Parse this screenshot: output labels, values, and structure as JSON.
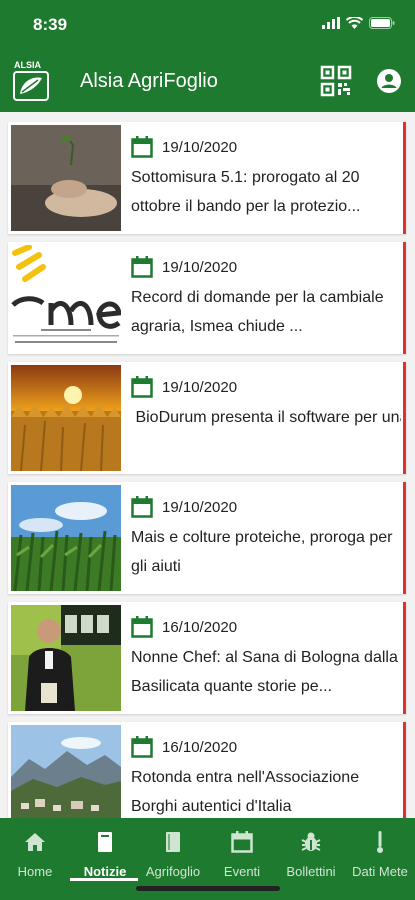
{
  "status_bar": {
    "time": "8:39"
  },
  "header": {
    "title": "Alsia AgriFoglio",
    "logo_text": "ALSIA"
  },
  "news": [
    {
      "date": "19/10/2020",
      "title": "Sottomisura 5.1: prorogato al 20 ottobre il bando per la protezio..."
    },
    {
      "date": "19/10/2020",
      "title": "Record di domande per la cambiale agraria, Ismea chiude ..."
    },
    {
      "date": "19/10/2020",
      "title": " BioDurum presenta il software per una gestione sostenibile del..."
    },
    {
      "date": "19/10/2020",
      "title": "Mais e colture proteiche, proroga per gli aiuti"
    },
    {
      "date": "16/10/2020",
      "title": "Nonne Chef: al Sana di Bologna dalla Basilicata quante storie pe..."
    },
    {
      "date": "16/10/2020",
      "title": "Rotonda entra nell'Associazione Borghi autentici d'Italia"
    }
  ],
  "nav": [
    {
      "label": "Home",
      "icon": "home-icon"
    },
    {
      "label": "Notizie",
      "icon": "news-icon",
      "active": true
    },
    {
      "label": "Agrifoglio",
      "icon": "book-icon"
    },
    {
      "label": "Eventi",
      "icon": "calendar-icon"
    },
    {
      "label": "Bollettini",
      "icon": "bug-icon"
    },
    {
      "label": "Dati Mete",
      "icon": "thermometer-icon"
    }
  ],
  "colors": {
    "primary": "#1e7a2e",
    "accent": "#e03030",
    "nav_inactive": "#cfe5d2"
  }
}
